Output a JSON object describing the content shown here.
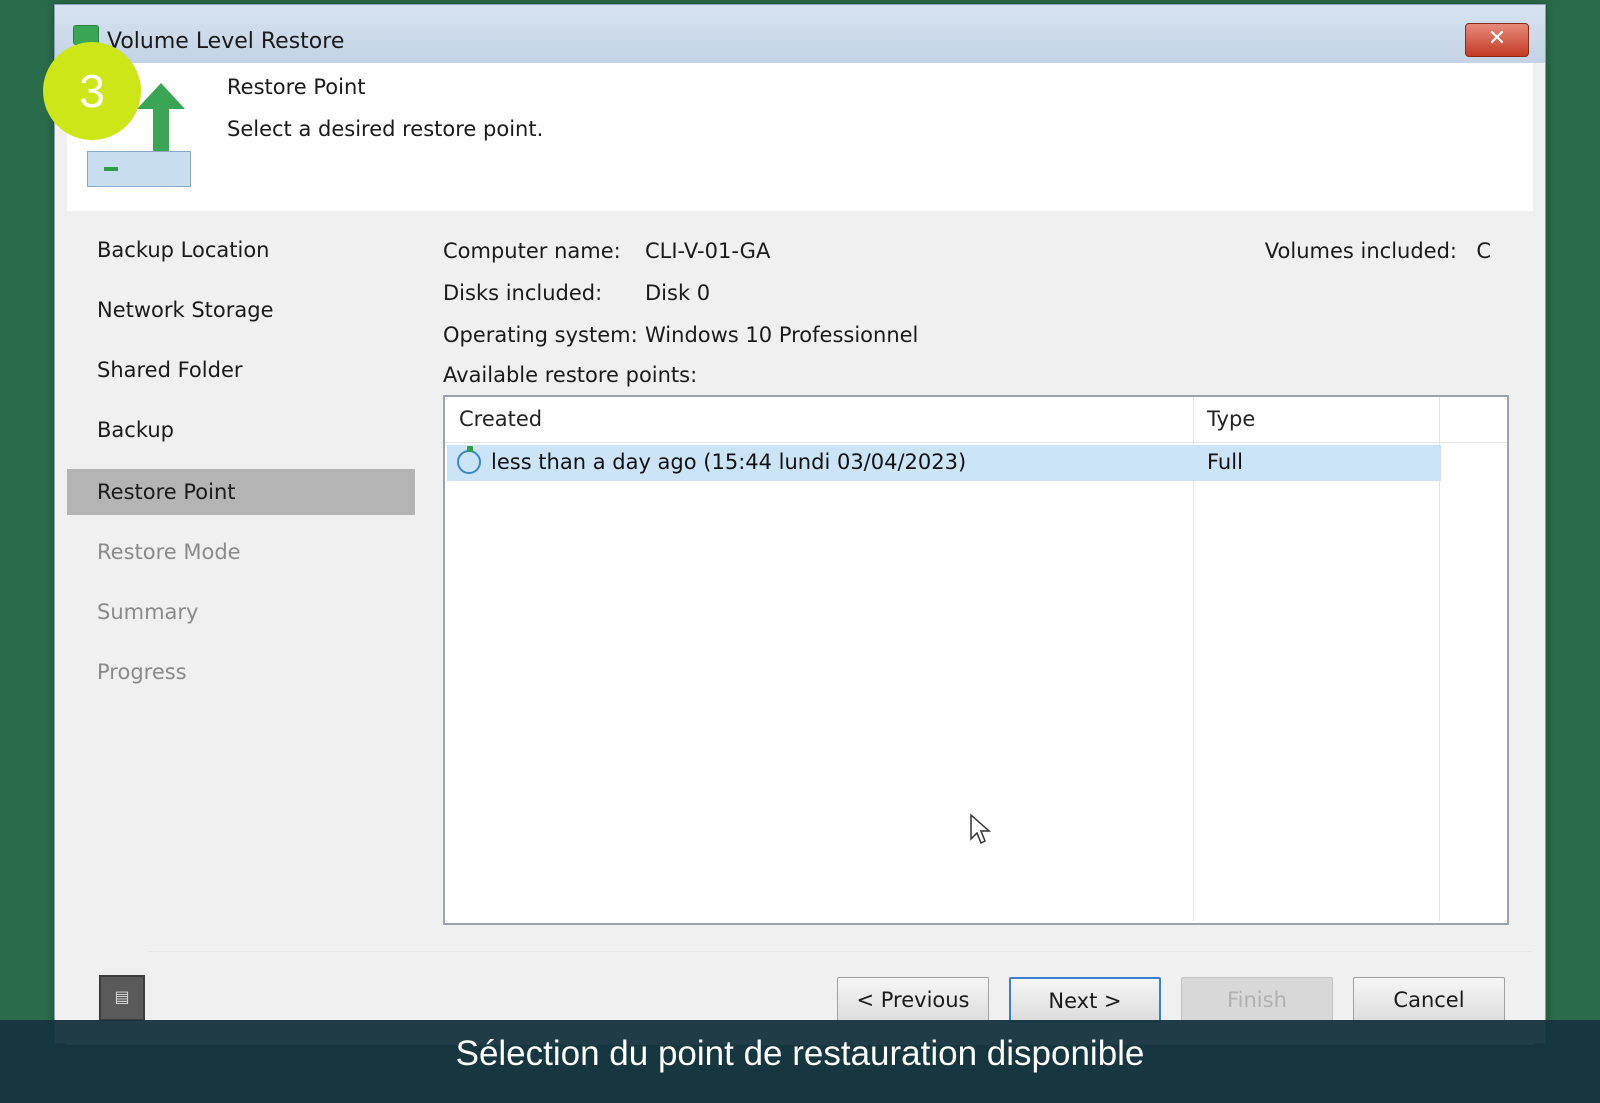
{
  "window": {
    "title": "Volume Level Restore",
    "close_glyph": "✕"
  },
  "header": {
    "title": "Restore Point",
    "subtitle": "Select a desired restore point."
  },
  "step_badge": "3",
  "sidebar": {
    "items": [
      {
        "label": "Backup Location",
        "state": "done"
      },
      {
        "label": "Network Storage",
        "state": "done"
      },
      {
        "label": "Shared Folder",
        "state": "done"
      },
      {
        "label": "Backup",
        "state": "done"
      },
      {
        "label": "Restore Point",
        "state": "active"
      },
      {
        "label": "Restore Mode",
        "state": "pending"
      },
      {
        "label": "Summary",
        "state": "pending"
      },
      {
        "label": "Progress",
        "state": "pending"
      }
    ]
  },
  "info": {
    "computer_name_label": "Computer name:",
    "computer_name_value": "CLI-V-01-GA",
    "disks_label": "Disks included:",
    "disks_value": "Disk 0",
    "os_label": "Operating system:",
    "os_value": "Windows 10 Professionnel",
    "volumes_label": "Volumes included:",
    "volumes_value": "C",
    "available_label": "Available restore points:"
  },
  "restore_points": {
    "columns": [
      "Created",
      "Type"
    ],
    "rows": [
      {
        "created": "less than a day ago (15:44 lundi 03/04/2023)",
        "type": "Full"
      }
    ]
  },
  "footer": {
    "previous": "< Previous",
    "next": "Next >",
    "finish": "Finish",
    "cancel": "Cancel"
  },
  "caption": "Sélection du point de restauration disponible",
  "icons": {
    "title": "app-icon",
    "header_arrow": "restore-arrow-icon",
    "header_drive": "drive-icon",
    "row": "restore-point-icon",
    "cursor": "mouse-cursor-icon",
    "help": "help-icon"
  },
  "colors": {
    "accent_green": "#2e9e48",
    "selection": "#cce4f7",
    "badge": "#cde618",
    "caption_bg": "#163440"
  }
}
